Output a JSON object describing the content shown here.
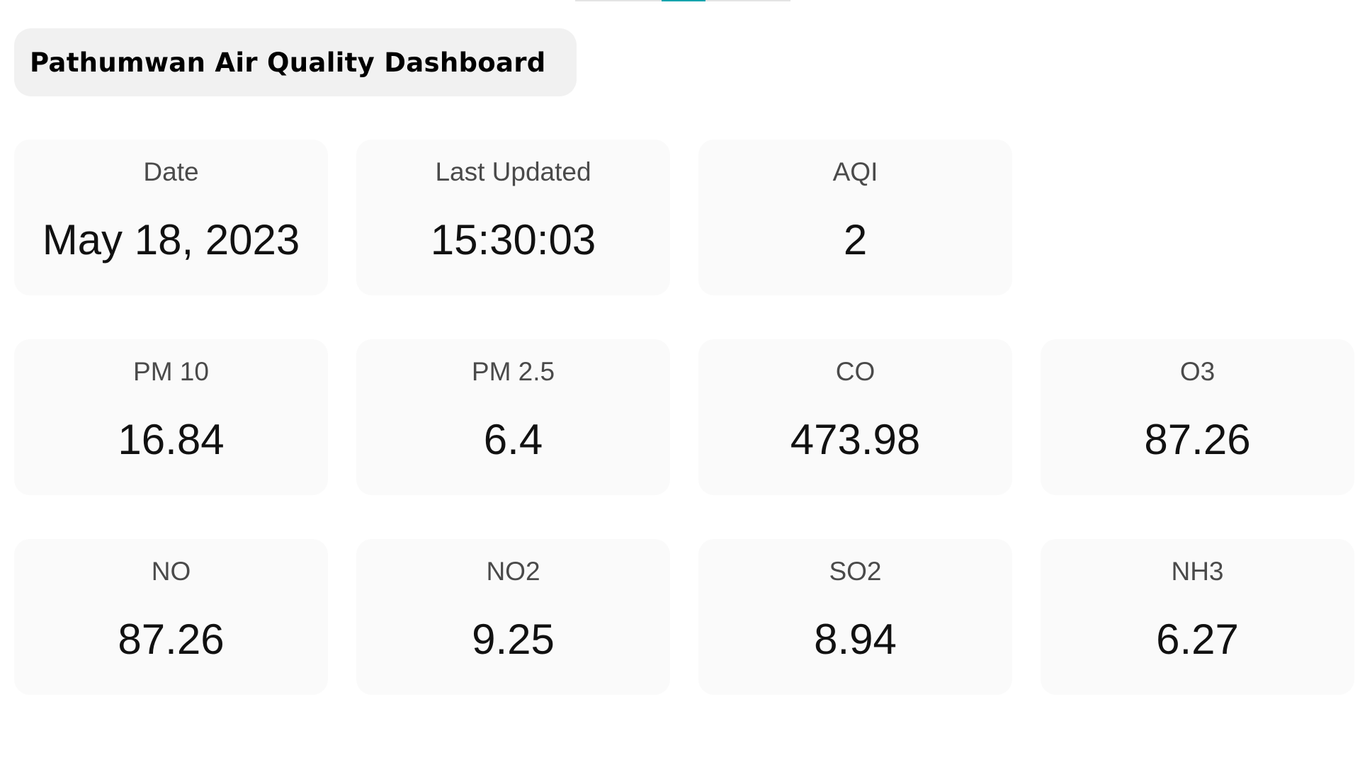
{
  "title": "Pathumwan Air Quality Dashboard",
  "info": [
    {
      "label": "Date",
      "value": "May 18, 2023"
    },
    {
      "label": "Last Updated",
      "value": "15:30:03"
    },
    {
      "label": "AQI",
      "value": "2"
    }
  ],
  "pollutants": [
    {
      "label": "PM 10",
      "value": "16.84"
    },
    {
      "label": "PM 2.5",
      "value": "6.4"
    },
    {
      "label": "CO",
      "value": "473.98"
    },
    {
      "label": "O3",
      "value": "87.26"
    },
    {
      "label": "NO",
      "value": "87.26"
    },
    {
      "label": "NO2",
      "value": "9.25"
    },
    {
      "label": "SO2",
      "value": "8.94"
    },
    {
      "label": "NH3",
      "value": "6.27"
    }
  ],
  "colors": {
    "card_background": "#fafafa",
    "title_background": "#f1f1f1",
    "tab_accent": "#12a4ad"
  }
}
